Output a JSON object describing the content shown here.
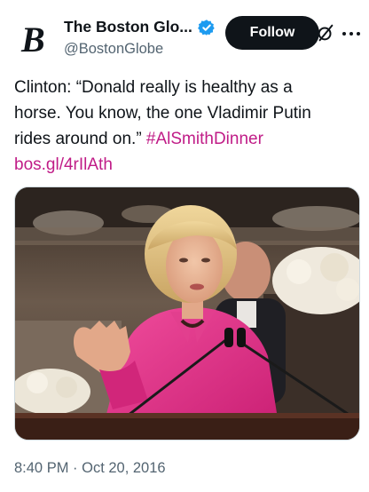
{
  "account": {
    "display_name": "The Boston Glo...",
    "handle": "@BostonGlobe",
    "verified": true,
    "logo_glyph": "B"
  },
  "actions": {
    "follow_label": "Follow",
    "grok_icon": "slashed-circle-icon",
    "more_icon": "more-dots-icon"
  },
  "tweet": {
    "line1": "Clinton: “Donald really is healthy as a",
    "line2": "horse. You know, the one Vladimir Putin",
    "line3_text": "rides around on.” ",
    "hashtag": "#AlSmithDinner",
    "link": "bos.gl/4rIlAth"
  },
  "media": {
    "description_icon": "photo-image"
  },
  "meta": {
    "timestamp": "8:40 PM · Oct 20, 2016"
  },
  "colors": {
    "accent_link": "#c01c87",
    "verified_blue": "#1d9bf0",
    "text_primary": "#0f1419",
    "text_secondary": "#536471"
  }
}
